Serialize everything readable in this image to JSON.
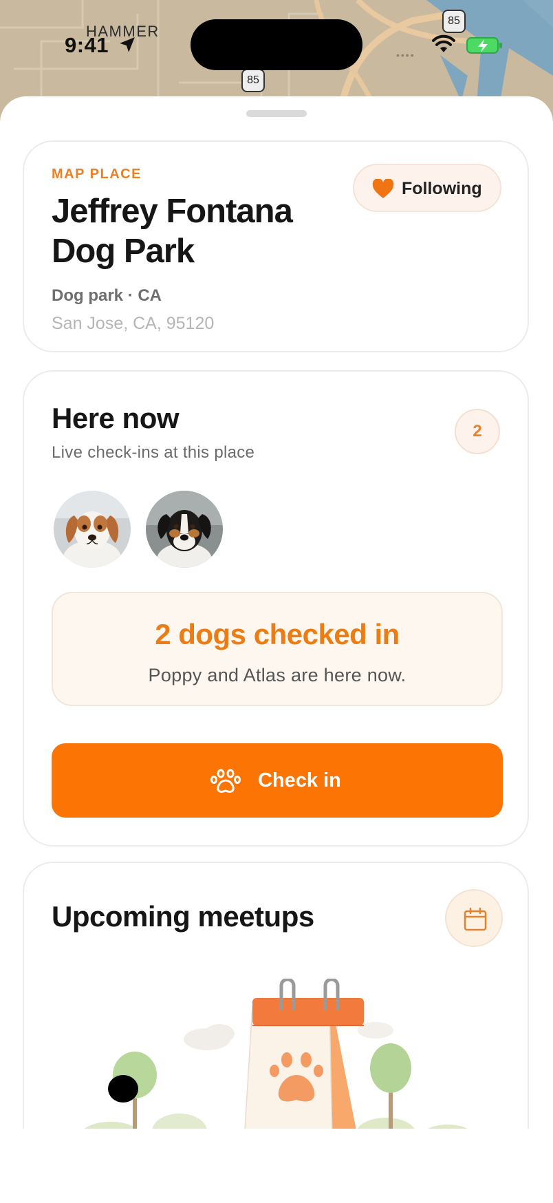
{
  "status_bar": {
    "time": "9:41",
    "carrier": "HAMMER"
  },
  "map": {
    "shields": [
      "85",
      "85"
    ]
  },
  "place": {
    "eyebrow": "MAP PLACE",
    "name": "Jeffrey Fontana Dog Park",
    "type_line": "Dog park · CA",
    "address": "San Jose, CA, 95120",
    "follow_label": "Following",
    "follow_icon": "heart-icon"
  },
  "here_now": {
    "title": "Here now",
    "subtitle": "Live check-ins at this place",
    "count": "2",
    "avatars": [
      "poppy-avatar",
      "atlas-avatar"
    ],
    "summary_title": "2 dogs checked in",
    "summary_text": "Poppy and Atlas are here now.",
    "checkin_label": "Check in",
    "checkin_icon": "paw-icon"
  },
  "meetups": {
    "title": "Upcoming meetups",
    "icon": "calendar-icon"
  },
  "colors": {
    "accent": "#fc7404",
    "accent_text": "#ec7d14",
    "soft_bg": "#fdf7ef"
  }
}
